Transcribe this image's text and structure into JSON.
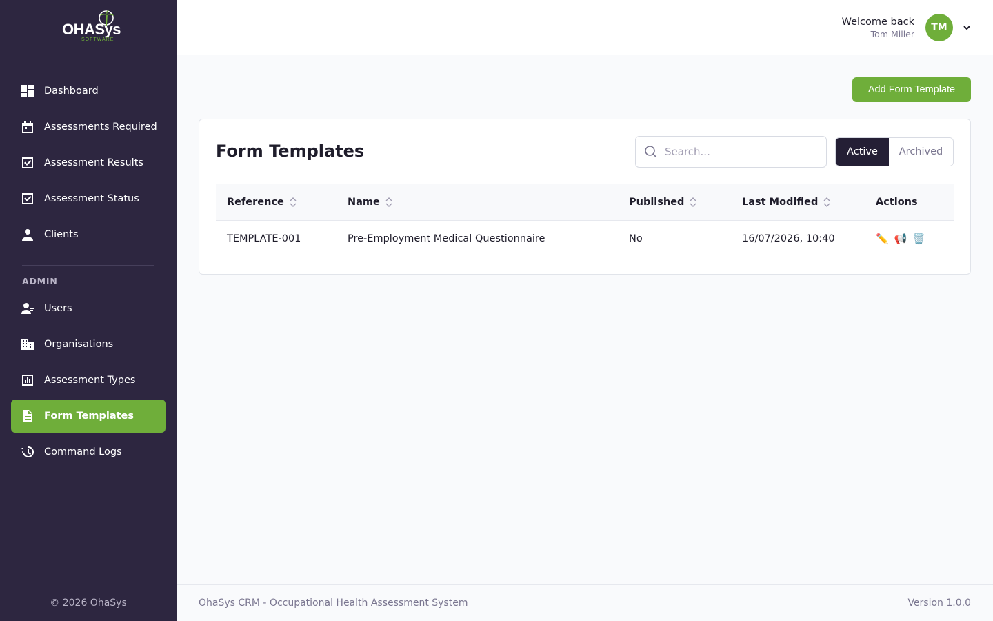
{
  "brand": {
    "logo_text": "OHASys",
    "logo_sub": "SOFTWARE",
    "accent_color": "#6fae3a",
    "sidebar_color": "#2d2640"
  },
  "sidebar": {
    "items": [
      {
        "label": "Dashboard",
        "icon": "dashboard-icon"
      },
      {
        "label": "Assessments Required",
        "icon": "calendar-icon"
      },
      {
        "label": "Assessment Results",
        "icon": "checkbox-icon"
      },
      {
        "label": "Assessment Status",
        "icon": "checkbox-icon"
      },
      {
        "label": "Clients",
        "icon": "person-icon"
      }
    ],
    "admin_section": "ADMIN",
    "admin_items": [
      {
        "label": "Users",
        "icon": "users-icon"
      },
      {
        "label": "Organisations",
        "icon": "building-icon"
      },
      {
        "label": "Assessment Types",
        "icon": "bar-chart-icon"
      },
      {
        "label": "Form Templates",
        "icon": "document-icon",
        "active": true
      },
      {
        "label": "Command Logs",
        "icon": "history-icon"
      }
    ],
    "footer": "© 2026 OhaSys"
  },
  "header": {
    "welcome": "Welcome back",
    "user_name": "Tom Miller",
    "avatar_initials": "TM"
  },
  "main": {
    "add_button": "Add Form Template",
    "card_title": "Form Templates",
    "search_placeholder": "Search...",
    "filters": {
      "active": "Active",
      "archived": "Archived",
      "selected": "Active"
    },
    "table": {
      "columns": [
        "Reference",
        "Name",
        "Published",
        "Last Modified",
        "Actions"
      ],
      "rows": [
        {
          "reference": "TEMPLATE-001",
          "name": "Pre-Employment Medical Questionnaire",
          "published": "No",
          "last_modified": "16/07/2026, 10:40",
          "actions": [
            "✏️",
            "📢",
            "🗑️"
          ]
        }
      ]
    }
  },
  "footer": {
    "left": "OhaSys CRM - Occupational Health Assessment System",
    "right": "Version 1.0.0"
  }
}
